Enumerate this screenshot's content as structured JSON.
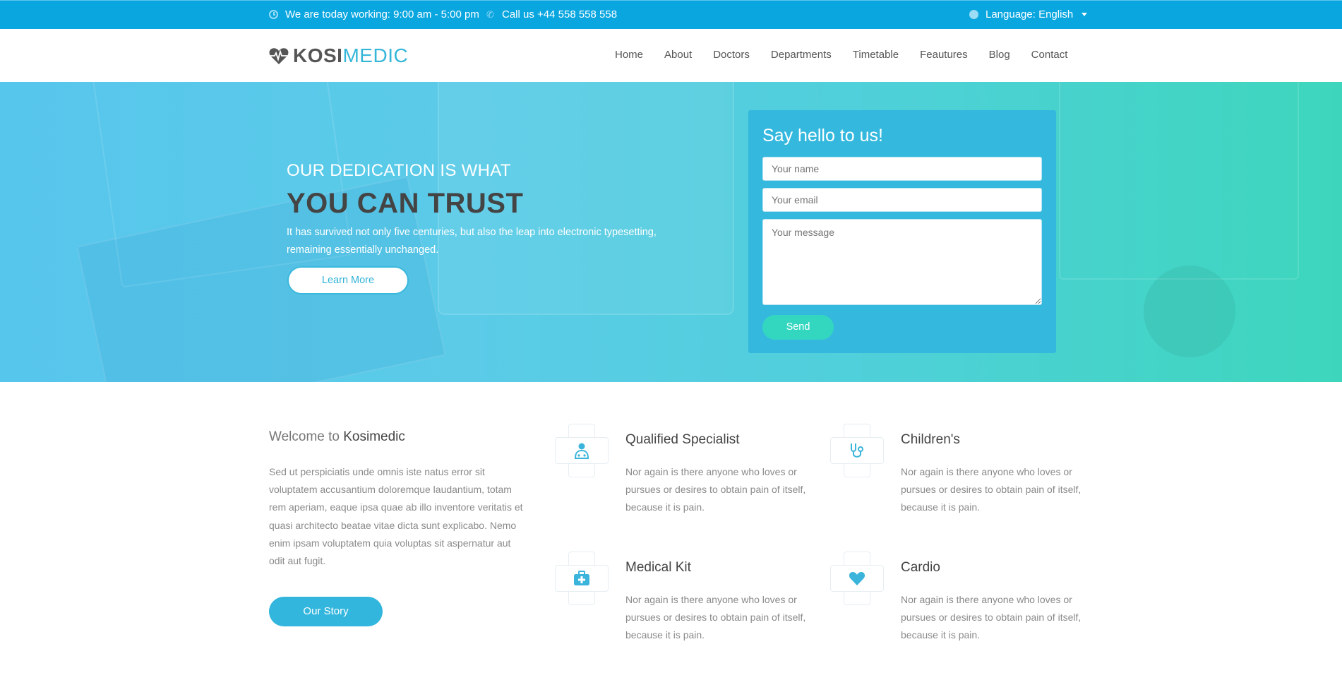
{
  "topbar": {
    "hours": "We are today working: 9:00 am - 5:00 pm",
    "phone": "Call us +44 558 558 558",
    "language": "Language: English"
  },
  "brand": {
    "logo_bold": "KOSI",
    "logo_light": "MEDIC"
  },
  "nav": [
    "Home",
    "About",
    "Doctors",
    "Departments",
    "Timetable",
    "Feautures",
    "Blog",
    "Contact"
  ],
  "hero": {
    "title_small": "OUR DEDICATION IS WHAT",
    "title_big": "YOU CAN TRUST",
    "text": "It has survived not only five centuries, but also the leap into electronic typesetting, remaining essentially unchanged.",
    "button": "Learn More"
  },
  "contact_form": {
    "title": "Say hello to us!",
    "name_placeholder": "Your name",
    "email_placeholder": "Your email",
    "message_placeholder": "Your message",
    "send": "Send"
  },
  "welcome": {
    "title_prefix": "Welcome to",
    "title_name": "Kosimedic",
    "text": "Sed ut perspiciatis unde omnis iste natus error sit voluptatem accusantium doloremque laudantium, totam rem aperiam, eaque ipsa quae ab illo inventore veritatis et quasi architecto beatae vitae dicta sunt explicabo. Nemo enim ipsam voluptatem quia voluptas sit aspernatur aut odit aut fugit.",
    "button": "Our Story"
  },
  "features": [
    {
      "title": "Qualified Specialist",
      "text": "Nor again is there anyone who loves or pursues or desires to obtain pain of itself, because it is pain.",
      "icon": "doctor-icon"
    },
    {
      "title": "Children's",
      "text": "Nor again is there anyone who loves or pursues or desires to obtain pain of itself, because it is pain.",
      "icon": "stethoscope-icon"
    },
    {
      "title": "Medical Kit",
      "text": "Nor again is there anyone who loves or pursues or desires to obtain pain of itself, because it is pain.",
      "icon": "medical-kit-icon"
    },
    {
      "title": "Cardio",
      "text": "Nor again is there anyone who loves or pursues or desires to obtain pain of itself, because it is pain.",
      "icon": "heart-icon"
    }
  ],
  "colors": {
    "topbar": "#0aa6e0",
    "accent": "#35b6d9",
    "send": "#33d7c0"
  }
}
